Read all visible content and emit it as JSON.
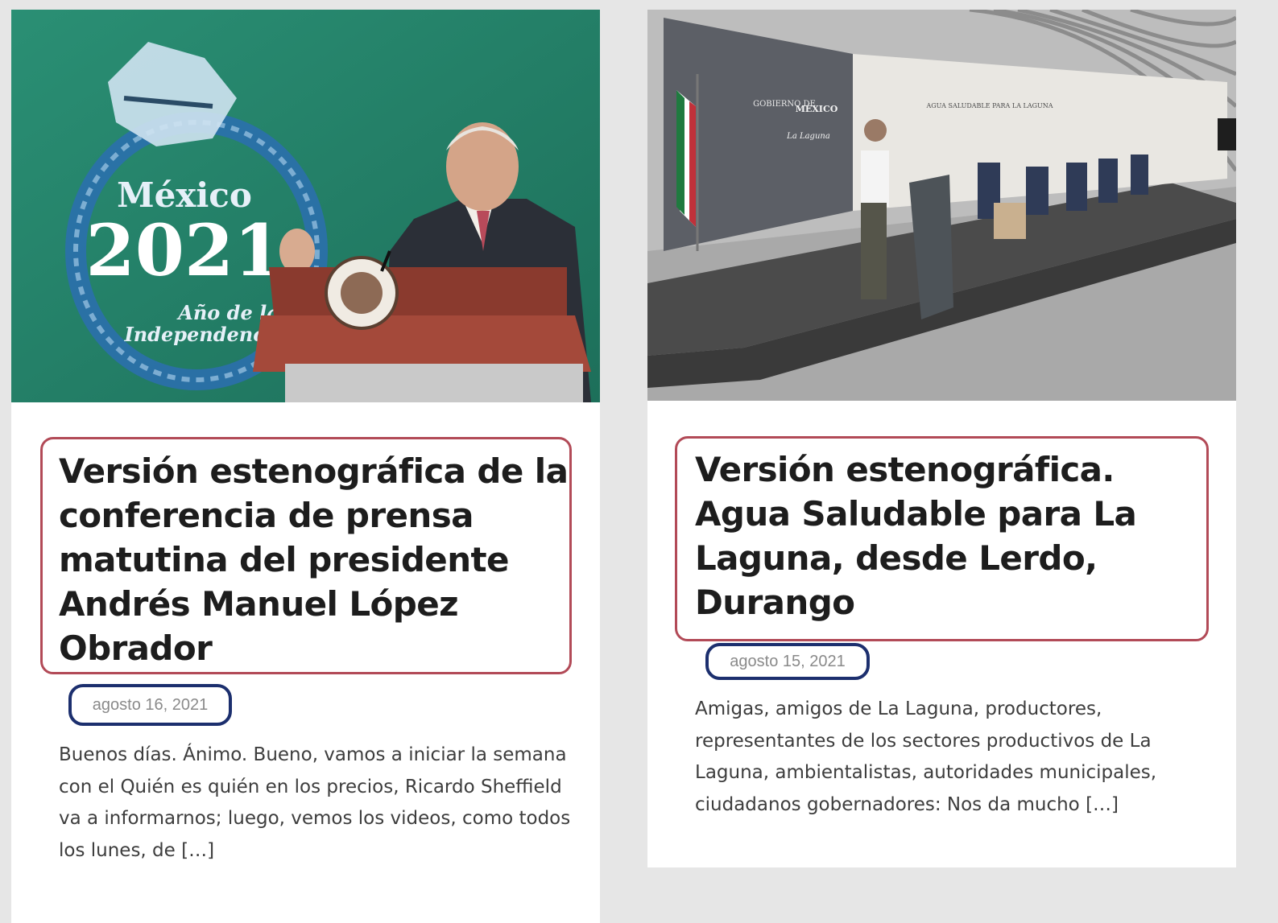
{
  "posts": [
    {
      "image_alt": "Conferencia de prensa matutina",
      "image_texts": [
        "México",
        "2021",
        "Año de la",
        "Independencia"
      ],
      "title": "Versión estenográfica de la conferencia de prensa matutina del presidente Andrés Manuel López Obrador",
      "date": "agosto 16, 2021",
      "excerpt": "Buenos días. Ánimo. Bueno, vamos a iniciar la semana con el Quién es quién en los precios, Ricardo Sheffield va a informarnos; luego, vemos los videos, como todos los lunes, de […]"
    },
    {
      "image_alt": "Agua Saludable para La Laguna",
      "image_texts": [
        "GOBIERNO DE",
        "MÉXICO",
        "La Laguna",
        "AGUA SALUDABLE PARA LA LAGUNA"
      ],
      "title": "Versión estenográfica. Agua Saludable para La Laguna, desde Lerdo, Durango",
      "date": "agosto 15, 2021",
      "excerpt": "Amigas, amigos de La Laguna, productores, representantes de los sectores productivos de La Laguna, ambientalistas, autoridades municipales, ciudadanos gobernadores: Nos da mucho […]"
    }
  ],
  "colors": {
    "page_bg": "#e6e6e6",
    "card_bg": "#ffffff",
    "title_highlight": "#b24a57",
    "date_highlight": "#1c2f6e",
    "date_text": "#8a8a8a"
  }
}
